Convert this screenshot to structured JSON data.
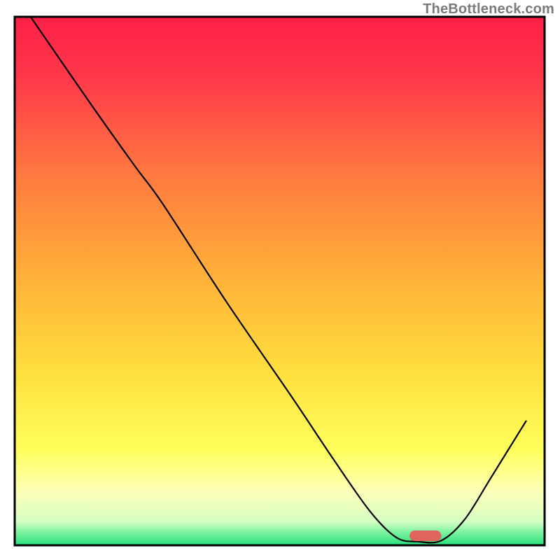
{
  "watermark": "TheBottleneck.com",
  "chart_data": {
    "type": "line",
    "title": "",
    "xlabel": "",
    "ylabel": "",
    "xlim": [
      0,
      100
    ],
    "ylim": [
      0,
      100
    ],
    "background": {
      "gradient_stops": [
        {
          "pos": 0.0,
          "color": "#ff1f47"
        },
        {
          "pos": 0.12,
          "color": "#ff3a4a"
        },
        {
          "pos": 0.3,
          "color": "#ff7a3f"
        },
        {
          "pos": 0.5,
          "color": "#ffb339"
        },
        {
          "pos": 0.68,
          "color": "#ffe13e"
        },
        {
          "pos": 0.82,
          "color": "#ffff5c"
        },
        {
          "pos": 0.9,
          "color": "#fcffb9"
        },
        {
          "pos": 0.955,
          "color": "#d6ffc3"
        },
        {
          "pos": 0.975,
          "color": "#7df2a0"
        },
        {
          "pos": 1.0,
          "color": "#28e07a"
        }
      ]
    },
    "series": [
      {
        "name": "bottleneck-curve",
        "color": "#000000",
        "width": 2.2,
        "x": [
          3.0,
          14.0,
          22.5,
          28.0,
          40.0,
          52.0,
          60.0,
          67.0,
          72.0,
          76.0,
          80.5,
          85.0,
          90.0,
          96.5
        ],
        "y": [
          100.0,
          84.0,
          72.0,
          64.5,
          46.0,
          28.5,
          16.5,
          6.5,
          1.5,
          0.7,
          0.9,
          5.0,
          13.0,
          23.5
        ]
      }
    ],
    "marker": {
      "name": "optimal-range-marker",
      "color": "#e0635e",
      "x_center": 77.5,
      "x_half_width": 3.0,
      "y": 1.8,
      "thickness": 2.0
    },
    "axes": {
      "frame_color": "#000000",
      "frame_width": 3.0
    }
  }
}
